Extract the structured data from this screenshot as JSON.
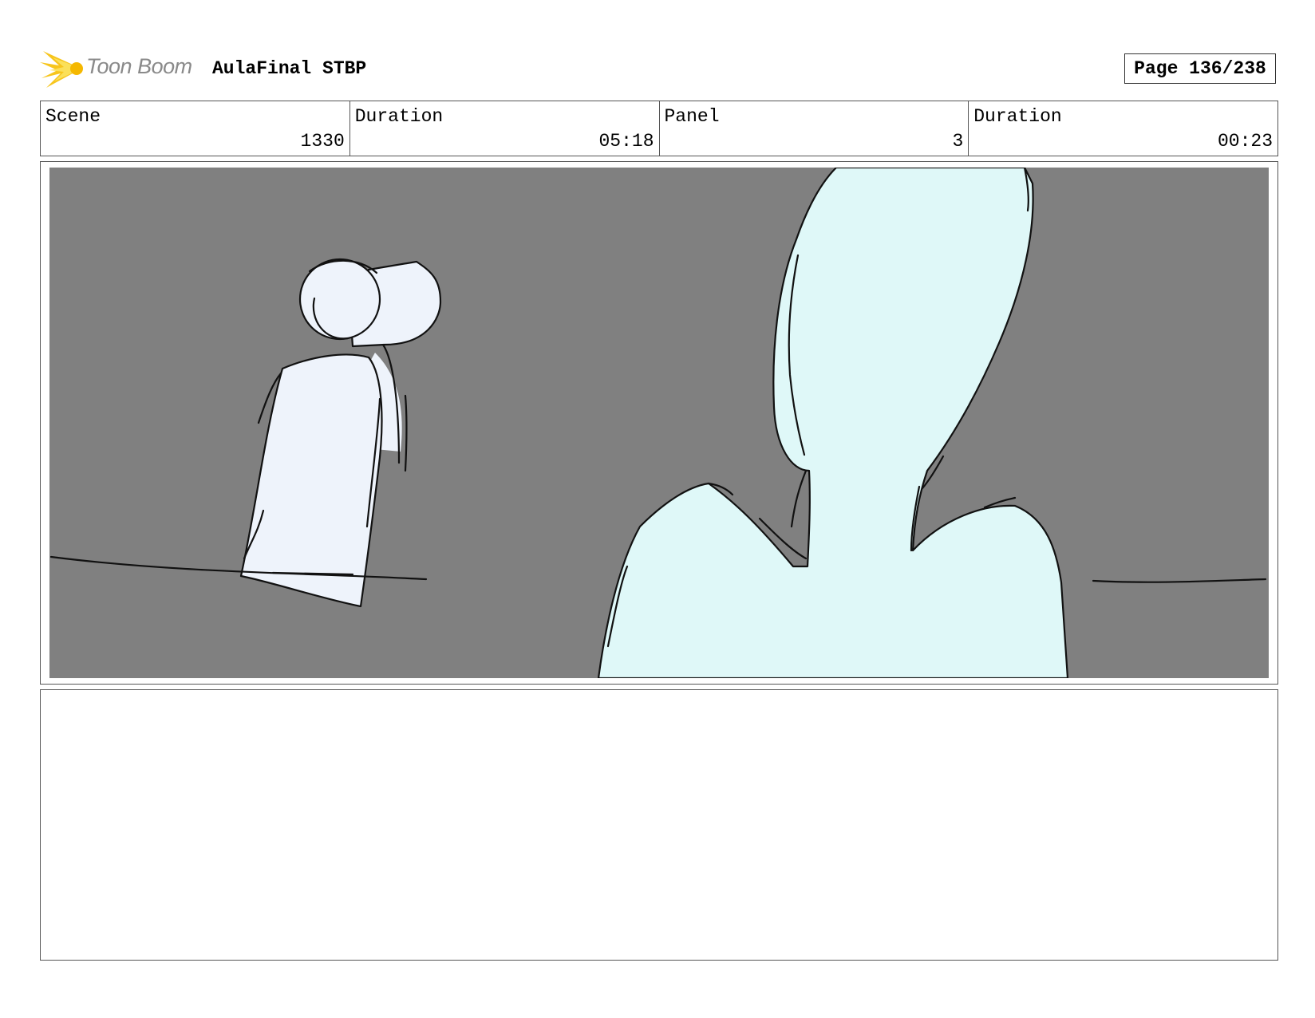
{
  "header": {
    "logo_text": "Toon Boom",
    "project_title": "AulaFinal STBP",
    "page_label": "Page 136/238"
  },
  "info": {
    "scene_label": "Scene",
    "scene_value": "1330",
    "scene_duration_label": "Duration",
    "scene_duration_value": "05:18",
    "panel_label": "Panel",
    "panel_value": "3",
    "panel_duration_label": "Duration",
    "panel_duration_value": "00:23"
  },
  "colors": {
    "panel_background": "#808080",
    "figure_left_fill": "#eef3fb",
    "figure_right_fill": "#dff8f8",
    "logo_yellow": "#f7c51c"
  },
  "notes": {
    "text": ""
  }
}
